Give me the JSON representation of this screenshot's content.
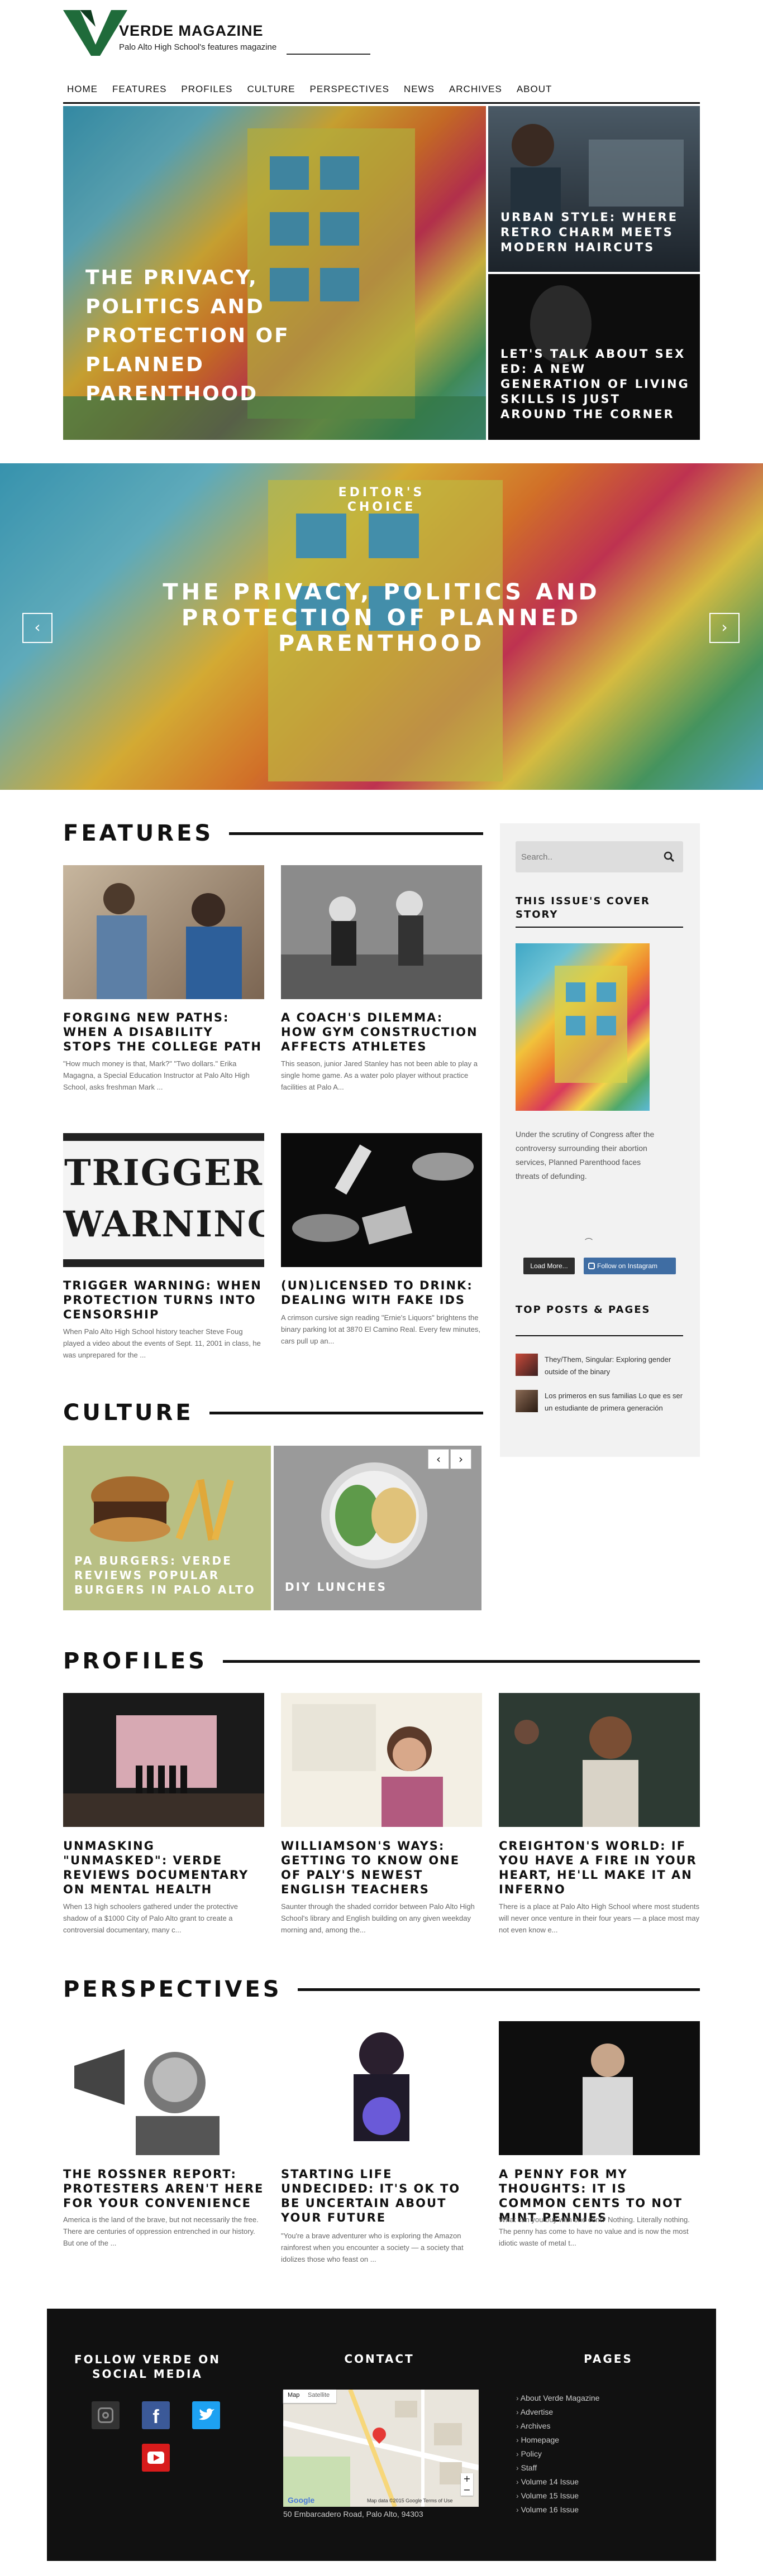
{
  "header": {
    "brand": "VERDE MAGAZINE",
    "tagline": "Palo Alto High School's features magazine"
  },
  "nav": [
    "HOME",
    "FEATURES",
    "PROFILES",
    "CULTURE",
    "PERSPECTIVES",
    "NEWS",
    "ARCHIVES",
    "ABOUT"
  ],
  "hero": {
    "main_title": "THE PRIVACY, POLITICS AND PROTECTION OF PLANNED PARENTHOOD",
    "side1": "URBAN STYLE: WHERE RETRO CHARM MEETS MODERN HAIRCUTS",
    "side2": "LET'S TALK ABOUT SEX ED: A NEW GENERATION OF LIVING SKILLS IS JUST AROUND THE CORNER"
  },
  "slider": {
    "label": "EDITOR'S CHOICE",
    "title": "THE PRIVACY, POLITICS AND PROTECTION OF PLANNED PARENTHOOD"
  },
  "features": {
    "heading": "FEATURES",
    "items": [
      {
        "title": "FORGING NEW PATHS: WHEN A DISABILITY STOPS THE COLLEGE PATH",
        "excerpt": "\"How much money is that, Mark?\" \"Two dollars.\" Erika Magagna, a Special Education Instructor at Palo Alto High School, asks freshman Mark ..."
      },
      {
        "title": "A COACH'S DILEMMA: HOW GYM CONSTRUCTION AFFECTS ATHLETES",
        "excerpt": "This season, junior Jared Stanley has not been able to play a single home game. As a water polo player without practice facilities at Palo A..."
      },
      {
        "title": "TRIGGER WARNING: WHEN PROTECTION TURNS INTO CENSORSHIP",
        "excerpt": "When Palo Alto High School history teacher Steve Foug played a video about the events of Sept. 11, 2001 in class, he was unprepared for the ..."
      },
      {
        "title": "(UN)LICENSED TO DRINK: DEALING WITH FAKE IDS",
        "excerpt": "A crimson cursive sign reading \"Ernie's Liquors\" brightens the binary parking lot at 3870 El Camino Real. Every few minutes, cars pull up an..."
      }
    ],
    "trigger_line1": "TRIGGER",
    "trigger_line2": "WARNING"
  },
  "sidebar": {
    "search_placeholder": "Search..",
    "cover_heading": "THIS ISSUE'S COVER STORY",
    "cover_text": "Under the scrutiny of Congress after the controversy surrounding their abortion services, Planned Parenthood faces threats of defunding.",
    "load_more": "Load More...",
    "follow_instagram": "Follow on Instagram",
    "top_heading": "TOP POSTS & PAGES",
    "top_posts": [
      "They/Them, Singular: Exploring gender outside of the binary",
      "Los primeros en sus familias Lo que es ser un estudiante de primera generación"
    ]
  },
  "culture": {
    "heading": "CULTURE",
    "items": [
      "PA BURGERS: VERDE REVIEWS POPULAR BURGERS IN PALO ALTO",
      "DIY LUNCHES"
    ]
  },
  "profiles": {
    "heading": "PROFILES",
    "items": [
      {
        "title": "UNMASKING \"UNMASKED\": VERDE REVIEWS DOCUMENTARY ON MENTAL HEALTH",
        "excerpt": "When 13 high schoolers gathered under the protective shadow of a $1000 City of Palo Alto grant to create a controversial documentary, many c..."
      },
      {
        "title": "WILLIAMSON'S WAYS: GETTING TO KNOW ONE OF PALY'S NEWEST ENGLISH TEACHERS",
        "excerpt": "Saunter through the shaded corridor between Palo Alto High School's library and English building on any given weekday morning and, among the..."
      },
      {
        "title": "CREIGHTON'S WORLD: IF YOU HAVE A FIRE IN YOUR HEART, HE'LL MAKE IT AN INFERNO",
        "excerpt": "There is a place at Palo Alto High School where most students will never once venture in their four years — a place most may not even know e..."
      }
    ]
  },
  "perspectives": {
    "heading": "PERSPECTIVES",
    "items": [
      {
        "title": "THE ROSSNER REPORT: PROTESTERS AREN'T HERE FOR YOUR CONVENIENCE",
        "excerpt": "America is the land of the brave, but not necessarily the free. There are centuries of oppression entrenched in our history. But one of the ..."
      },
      {
        "title": "STARTING LIFE UNDECIDED: IT'S OK TO BE UNCERTAIN ABOUT YOUR FUTURE",
        "excerpt": "\"You're a brave adventurer who is exploring the Amazon rainforest when you encounter a society — a society that idolizes those who feast on ..."
      },
      {
        "title": "A PENNY FOR MY THOUGHTS: IT IS COMMON CENTS TO NOT MINT PENNIES",
        "excerpt": "What can you buy with one cent? Nothing. Literally nothing. The penny has come to have no value and is now the most idiotic waste of metal t..."
      }
    ]
  },
  "footer": {
    "follow_heading": "FOLLOW VERDE ON SOCIAL MEDIA",
    "contact_heading": "CONTACT",
    "pages_heading": "PAGES",
    "map_tab1": "Map",
    "map_tab2": "Satellite",
    "map_google": "Google",
    "map_data": "Map data ©2015 Google  Terms of Use",
    "address": "50 Embarcadero Road, Palo Alto, 94303",
    "pages": [
      "About Verde Magazine",
      "Advertise",
      "Archives",
      "Homepage",
      "Policy",
      "Staff",
      "Volume 14 Issue",
      "Volume 15 Issue",
      "Volume 16 Issue"
    ]
  }
}
